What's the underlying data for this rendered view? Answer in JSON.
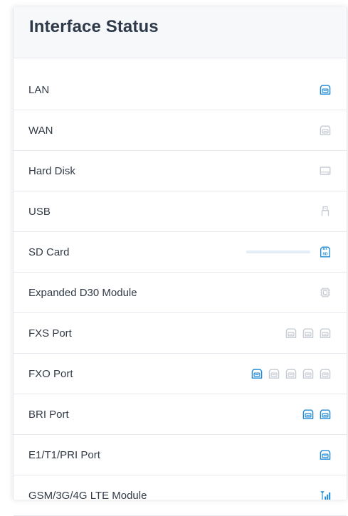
{
  "panel": {
    "title": "Interface Status"
  },
  "colors": {
    "active": "#1e8ad6",
    "inactive": "#c6cbd3",
    "text": "#333b47",
    "title": "#2e3a4a"
  },
  "rows": [
    {
      "label": "LAN",
      "icons": [
        {
          "type": "port-icon",
          "active": true
        }
      ]
    },
    {
      "label": "WAN",
      "icons": [
        {
          "type": "port-icon",
          "active": false
        }
      ]
    },
    {
      "label": "Hard Disk",
      "icons": [
        {
          "type": "hard-disk-icon",
          "active": false
        }
      ]
    },
    {
      "label": "USB",
      "icons": [
        {
          "type": "usb-icon",
          "active": false
        }
      ]
    },
    {
      "label": "SD Card",
      "progress": 0,
      "icons": [
        {
          "type": "sd-card-icon",
          "active": true
        }
      ]
    },
    {
      "label": "Expanded D30 Module",
      "icons": [
        {
          "type": "chip-icon",
          "active": false
        }
      ]
    },
    {
      "label": "FXS Port",
      "icons": [
        {
          "type": "port-icon",
          "active": false
        },
        {
          "type": "port-icon",
          "active": false
        },
        {
          "type": "port-icon",
          "active": false
        }
      ]
    },
    {
      "label": "FXO Port",
      "icons": [
        {
          "type": "port-icon",
          "active": true
        },
        {
          "type": "port-icon",
          "active": false
        },
        {
          "type": "port-icon",
          "active": false
        },
        {
          "type": "port-icon",
          "active": false
        },
        {
          "type": "port-icon",
          "active": false
        }
      ]
    },
    {
      "label": "BRI Port",
      "icons": [
        {
          "type": "port-icon",
          "active": true
        },
        {
          "type": "port-icon",
          "active": true
        }
      ]
    },
    {
      "label": "E1/T1/PRI Port",
      "icons": [
        {
          "type": "port-icon",
          "active": true
        }
      ]
    },
    {
      "label": "GSM/3G/4G LTE Module",
      "icons": [
        {
          "type": "signal-icon",
          "active": true
        }
      ]
    }
  ]
}
